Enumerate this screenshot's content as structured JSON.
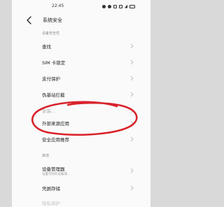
{
  "status": {
    "time": "22:45"
  },
  "header": {
    "title": "系统安全"
  },
  "section_device": {
    "label": "设备安全性"
  },
  "rows": [
    {
      "title": "查找"
    },
    {
      "title": "SIM 卡锁定"
    },
    {
      "title": "支付保护"
    },
    {
      "title": "伪基站拦截"
    },
    {
      "title": "安装..."
    },
    {
      "title": "外部来源应用"
    },
    {
      "title": "安全应用推荐"
    }
  ],
  "section_other": {
    "label": "其他"
  },
  "device_manager": {
    "title": "设备管理器",
    "subtitle": "设置可控的设备或..."
  },
  "credentials": {
    "title": "凭据存储"
  },
  "last_row": {
    "title": "隐私保护"
  },
  "annotation_color": "#d9222a"
}
